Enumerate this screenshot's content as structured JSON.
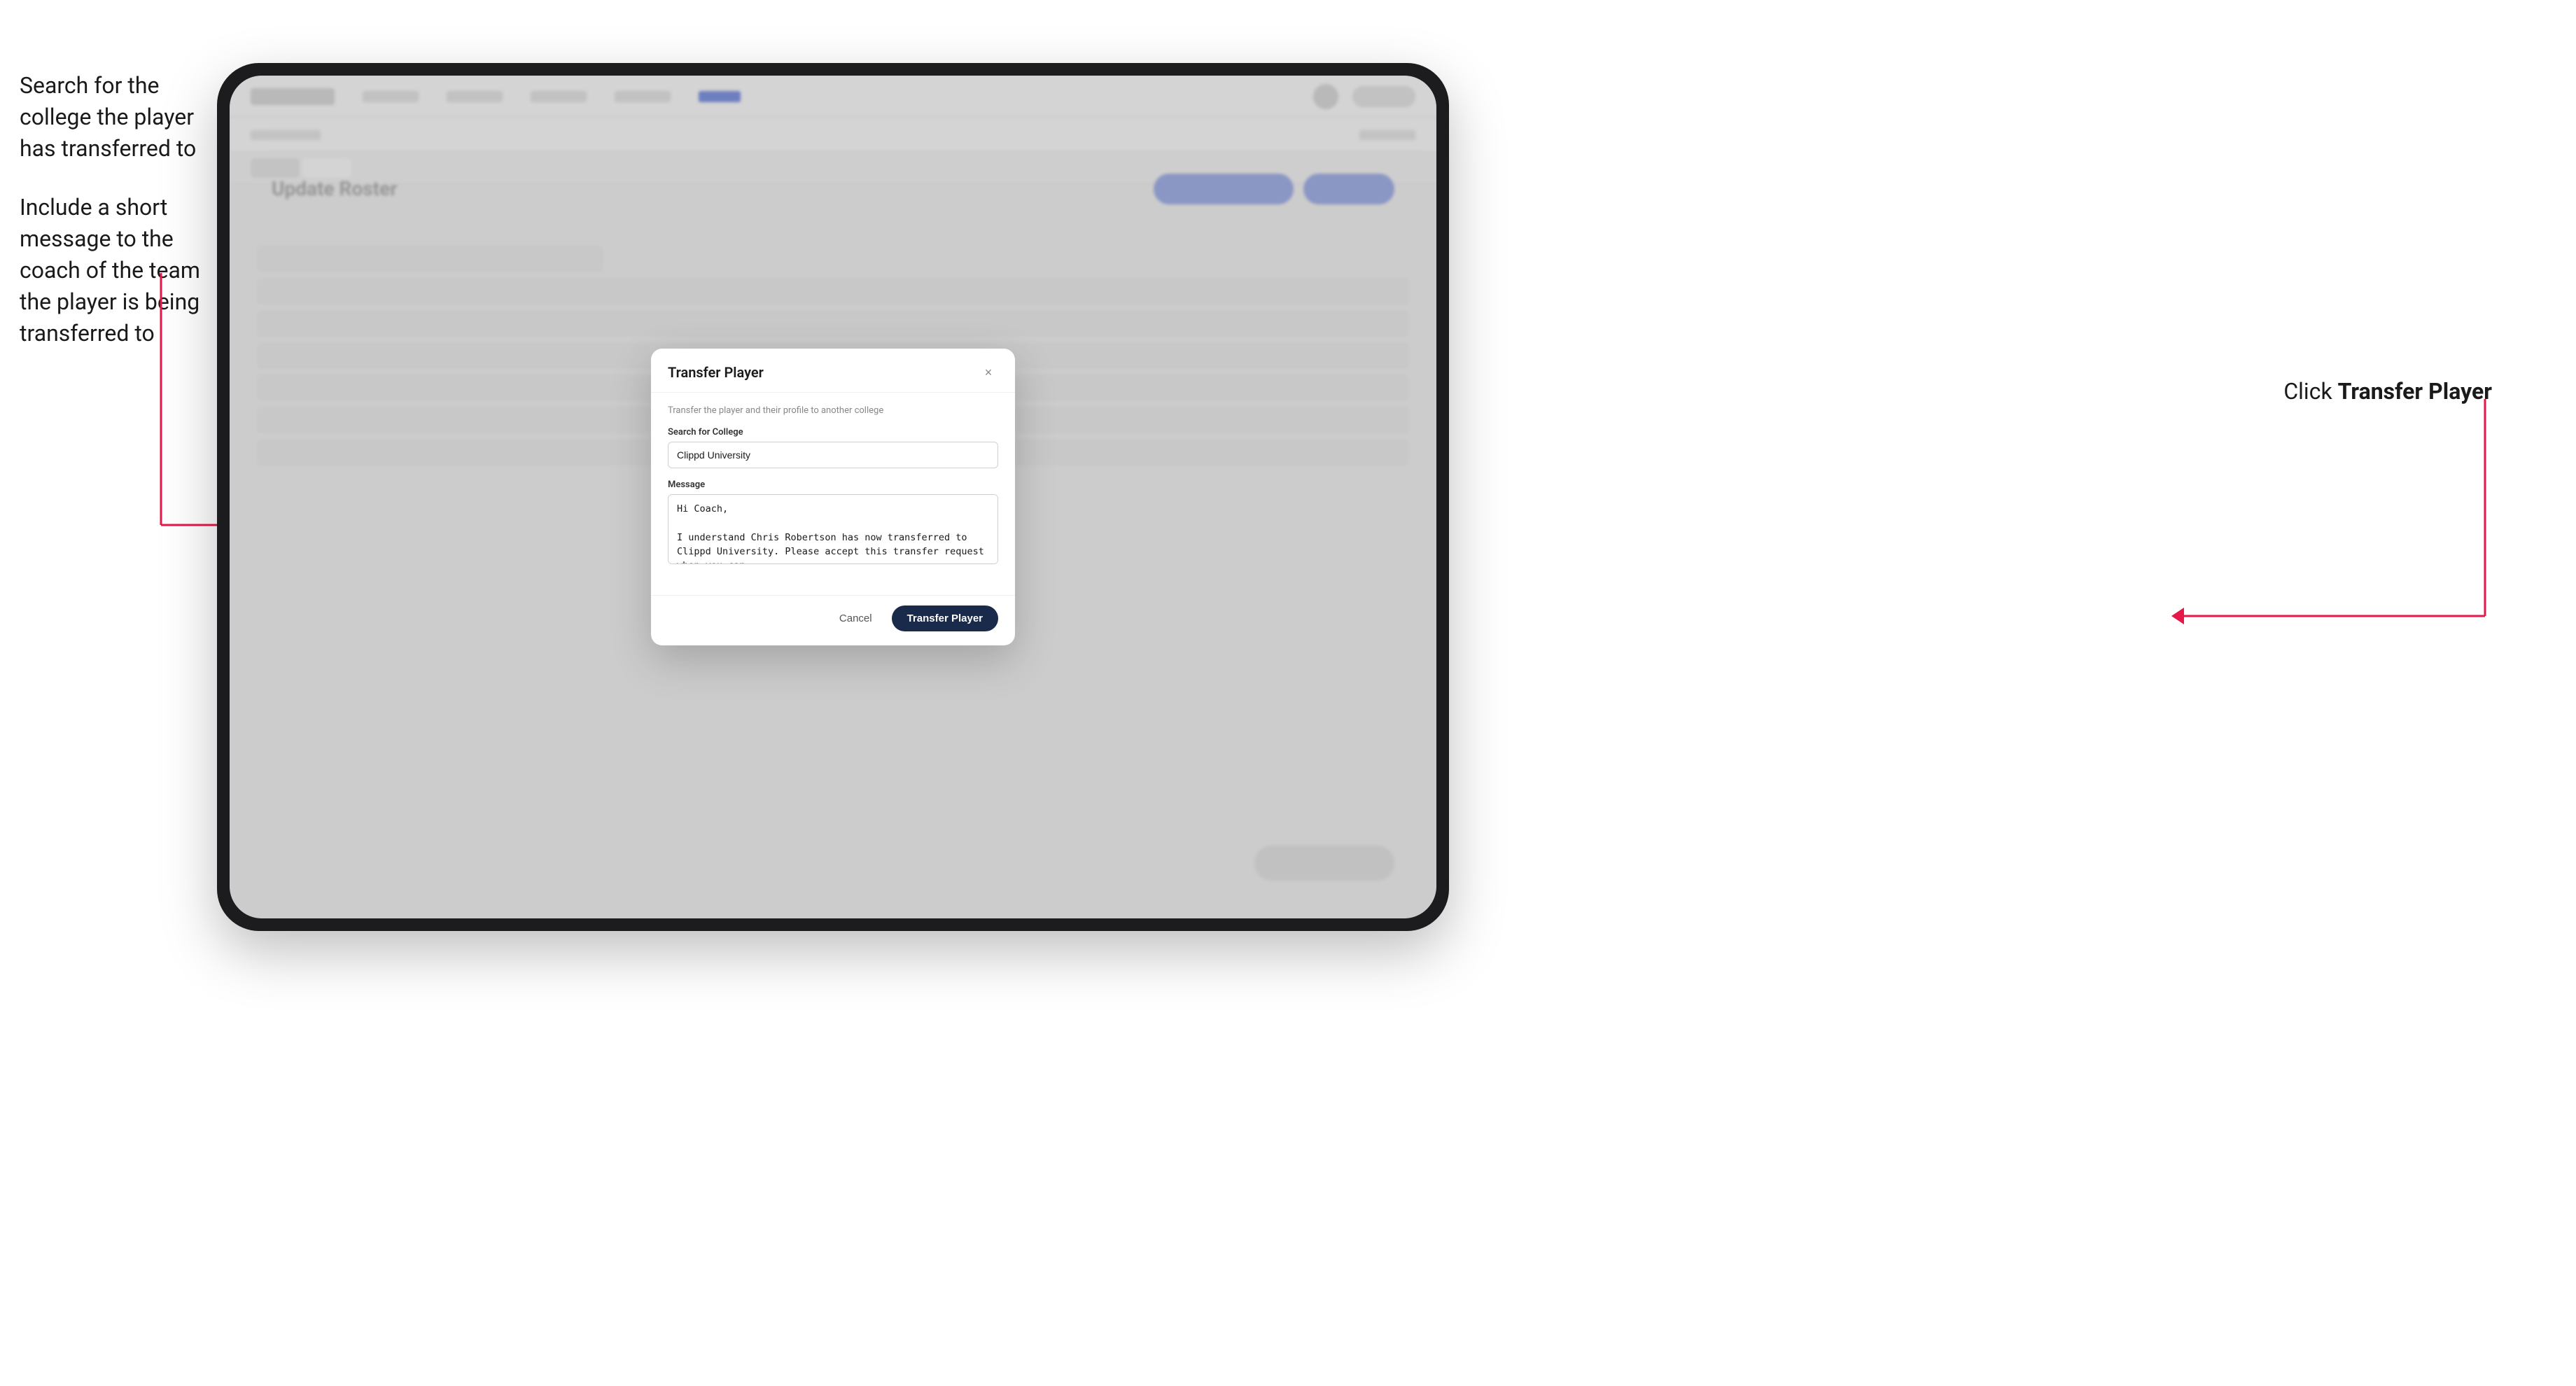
{
  "annotations": {
    "left_text_1": "Search for the college the player has transferred to",
    "left_text_2": "Include a short message to the coach of the team the player is being transferred to",
    "right_text_prefix": "Click ",
    "right_text_bold": "Transfer Player"
  },
  "tablet": {
    "nav": {
      "logo": "logo",
      "items": [
        "Community",
        "Team",
        "Statistics",
        "More Info",
        "Active"
      ],
      "active_item": "Active"
    },
    "subheader": {
      "breadcrumb": "Basketball (F1)",
      "right_label": "Order ↓"
    },
    "tabs": [
      "List",
      "Roster"
    ],
    "active_tab": "Roster",
    "content_title": "Update Roster"
  },
  "modal": {
    "title": "Transfer Player",
    "close_label": "×",
    "subtitle": "Transfer the player and their profile to another college",
    "search_label": "Search for College",
    "search_value": "Clippd University",
    "message_label": "Message",
    "message_value": "Hi Coach,\n\nI understand Chris Robertson has now transferred to Clippd University. Please accept this transfer request when you can.",
    "cancel_label": "Cancel",
    "transfer_label": "Transfer Player"
  }
}
